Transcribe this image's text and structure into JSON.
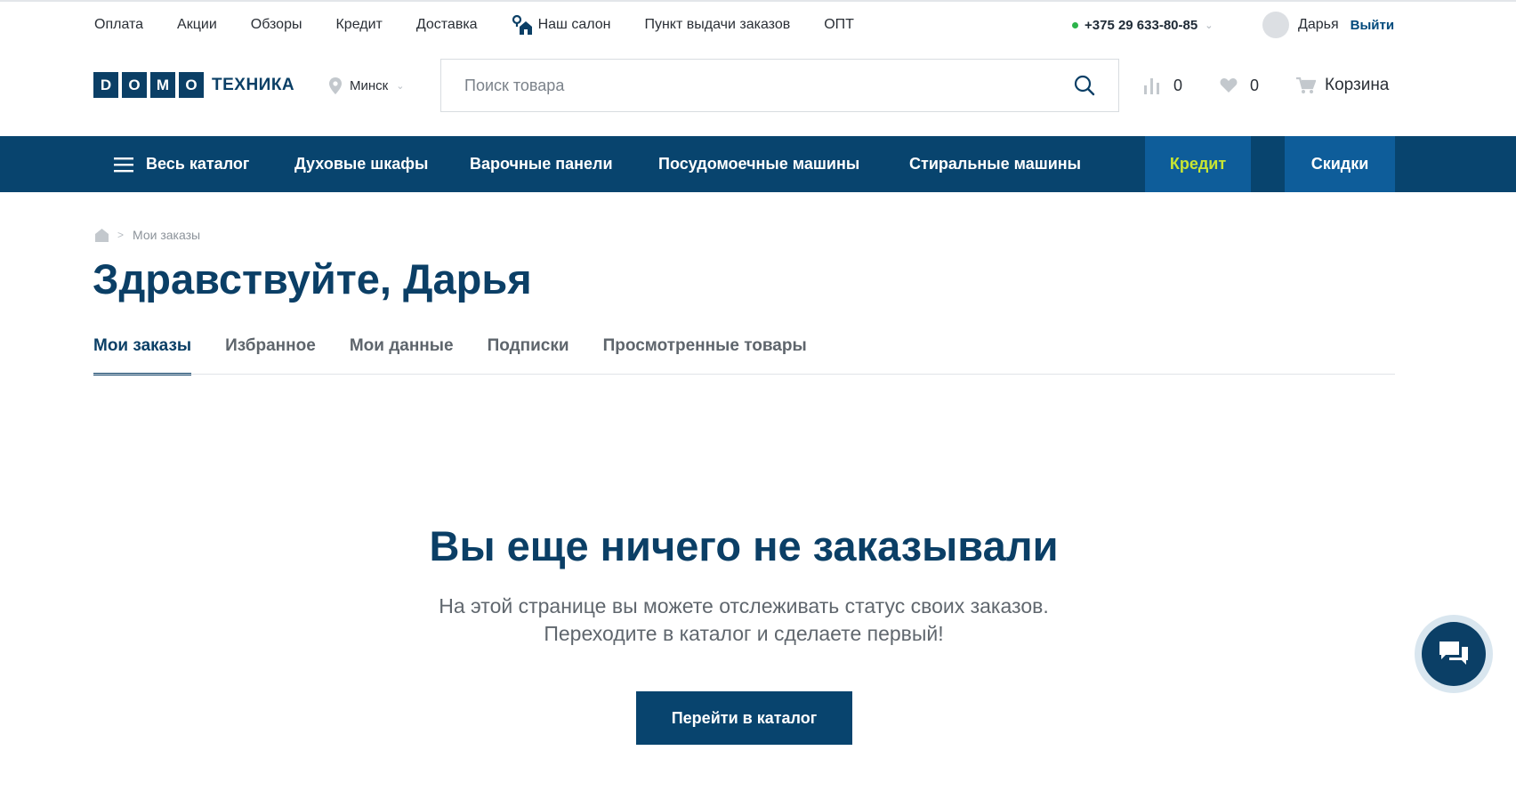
{
  "toplinks": [
    "Оплата",
    "Акции",
    "Обзоры",
    "Кредит",
    "Доставка",
    "Наш салон",
    "Пункт выдачи заказов",
    "ОПТ"
  ],
  "phone": "+375 29 633-80-85",
  "user": {
    "name": "Дарья",
    "logout": "Выйти"
  },
  "logo": {
    "letters": [
      "D",
      "O",
      "M",
      "O"
    ],
    "text": "ТЕХНИКА"
  },
  "city": "Минск",
  "search": {
    "placeholder": "Поиск товара"
  },
  "counters": {
    "compare": "0",
    "favorites": "0"
  },
  "cart": "Корзина",
  "nav": {
    "catalog": "Весь каталог",
    "items": [
      "Духовые шкафы",
      "Варочные панели",
      "Посудомоечные машины",
      "Стиральные машины"
    ],
    "credit": "Кредит",
    "sale": "Скидки"
  },
  "breadcrumb": {
    "current": "Мои заказы"
  },
  "greeting": "Здравствуйте, Дарья",
  "tabs": [
    "Мои заказы",
    "Избранное",
    "Мои данные",
    "Подписки",
    "Просмотренные товары"
  ],
  "empty": {
    "title": "Вы еще ничего не заказывали",
    "desc": "На этой странице вы можете отслеживать статус своих заказов. Переходите в каталог и сделаете первый!",
    "button": "Перейти в каталог"
  },
  "colors": {
    "brand": "#08446e",
    "accent_credit": "#c8e632",
    "online_dot": "#2cb34a"
  },
  "icons": [
    "location-home-icon",
    "map-pin-icon",
    "search-icon",
    "compare-icon",
    "heart-icon",
    "cart-icon",
    "menu-icon",
    "home-icon",
    "chat-icon"
  ]
}
